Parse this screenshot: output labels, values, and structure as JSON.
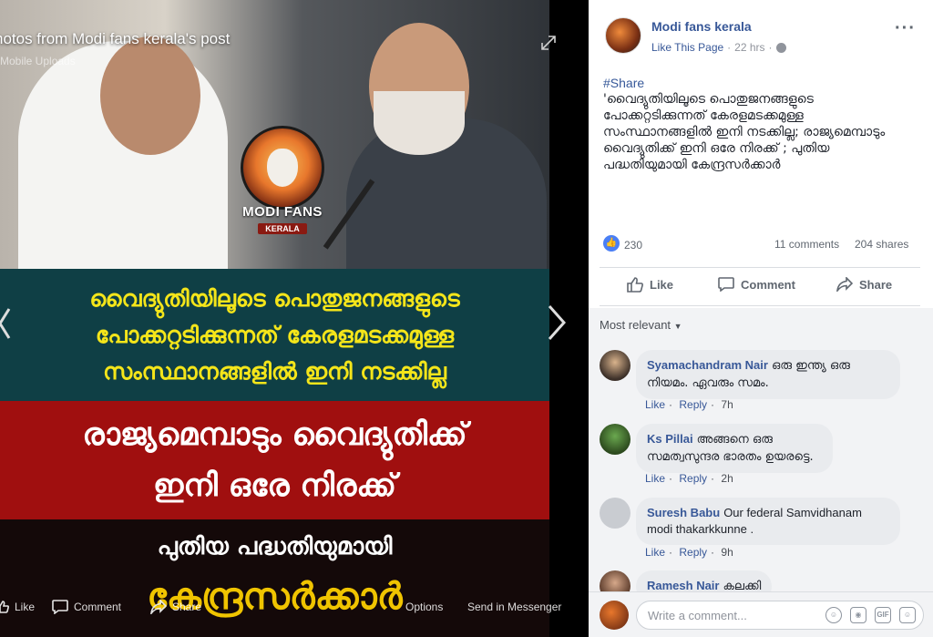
{
  "viewer": {
    "caption_title": "hotos from Modi fans kerala's post",
    "caption_sub": "Mobile Uploads",
    "logo_line1": "MODI FANS",
    "logo_line2": "KERALA",
    "band1": [
      "വൈദ്യുതിയിലൂടെ പൊതുജനങ്ങളുടെ",
      "പോക്കറ്റടിക്കുന്നത് കേരളമടക്കമുള്ള",
      "സംസ്ഥാനങ്ങളിൽ ഇനി നടക്കില്ല"
    ],
    "band2": [
      "രാജ്യമെമ്പാടും വൈദ്യുതിക്ക്",
      "ഇനി ഒരേ നിരക്ക്"
    ],
    "band3": "പുതിയ പദ്ധതിയുമായി",
    "band4": "കേന്ദ്രസർക്കാർ",
    "bar": {
      "like": "Like",
      "comment": "Comment",
      "share": "Share",
      "options": "Options",
      "send": "Send in Messenger"
    }
  },
  "post": {
    "page_name": "Modi fans kerala",
    "like_page": "Like This Page",
    "time": "22 hrs",
    "hashtag": "#Share",
    "text": "'വൈദ്യുതിയിലൂടെ പൊതുജനങ്ങളുടെ പോക്കറ്റടിക്കുന്നത് കേരളമടക്കമുള്ള സംസ്ഥാനങ്ങളിൽ ഇനി നടക്കില്ല; രാജ്യമെമ്പാടും വൈദ്യുതിക്ക് ഇനി ഒരേ നിരക്ക് ; പുതിയ പദ്ധതിയുമായി കേന്ദ്രസർക്കാർ",
    "reactions": "230",
    "comments": "11 comments",
    "shares": "204 shares",
    "actions": {
      "like": "Like",
      "comment": "Comment",
      "share": "Share"
    }
  },
  "comments": {
    "sort_label": "Most relevant",
    "items": [
      {
        "name": "Syamachandram Nair",
        "text": "ഒരു ഇന്ത്യ ഒരു നിയമം. ഏവരും സമം.",
        "like": "Like",
        "reply": "Reply",
        "time": "7h"
      },
      {
        "name": "Ks Pillai",
        "text": "അങ്ങനെ ഒരു സമത്വസുന്ദര ഭാരതം ഉയരട്ടെ.",
        "like": "Like",
        "reply": "Reply",
        "time": "2h"
      },
      {
        "name": "Suresh Babu",
        "text": "Our federal Samvidhanam modi thakarkkunne .",
        "like": "Like",
        "reply": "Reply",
        "time": "9h"
      },
      {
        "name": "Ramesh Nair",
        "text": "കലക്കി"
      }
    ],
    "write_placeholder": "Write a comment...",
    "gif_label": "GIF"
  },
  "colors": {
    "link": "#385898",
    "band1_text": "#f4e51a",
    "band2_bg": "#a00f0f",
    "band4_text": "#f0c400"
  }
}
